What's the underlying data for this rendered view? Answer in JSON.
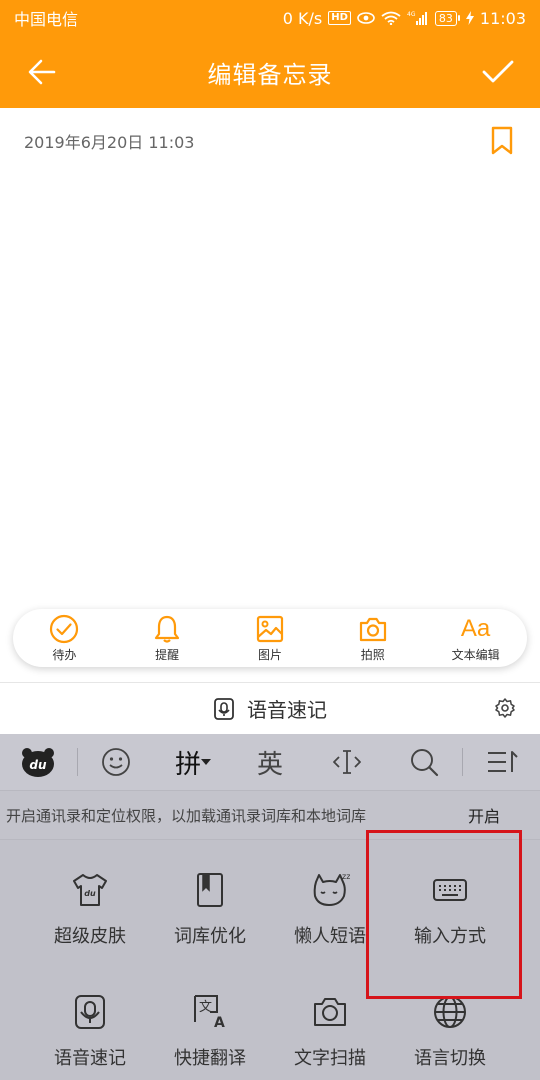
{
  "status_bar": {
    "carrier": "中国电信",
    "speed": "0 K/s",
    "hd": "HD",
    "network": "4G",
    "battery": "83",
    "time": "11:03"
  },
  "app_bar": {
    "title": "编辑备忘录",
    "back_icon": "arrow-left",
    "confirm_icon": "checkmark"
  },
  "note": {
    "date": "2019年6月20日 11:03",
    "bookmark_icon": "bookmark"
  },
  "toolbar": {
    "items": [
      {
        "label": "待办",
        "icon": "check-circle"
      },
      {
        "label": "提醒",
        "icon": "bell"
      },
      {
        "label": "图片",
        "icon": "image"
      },
      {
        "label": "拍照",
        "icon": "camera"
      },
      {
        "label": "文本编辑",
        "icon": "Aa"
      }
    ]
  },
  "voice_bar": {
    "label": "语音速记"
  },
  "keyboard": {
    "top_keys": [
      "du",
      "emoji",
      "拼",
      "英",
      "cursor",
      "search",
      "menu"
    ],
    "pinyin_label": "拼",
    "english_label": "英",
    "permission_text": "开启通讯录和定位权限，以加载通讯录词库和本地词库",
    "permission_action": "开启",
    "tools": [
      {
        "label": "超级皮肤",
        "icon": "tshirt-icon"
      },
      {
        "label": "词库优化",
        "icon": "book-icon"
      },
      {
        "label": "懒人短语",
        "icon": "sleeping-cat-icon"
      },
      {
        "label": "输入方式",
        "icon": "keyboard-icon"
      },
      {
        "label": "语音速记",
        "icon": "voice-note-icon"
      },
      {
        "label": "快捷翻译",
        "icon": "translate-icon"
      },
      {
        "label": "文字扫描",
        "icon": "camera-icon"
      },
      {
        "label": "语言切换",
        "icon": "globe-icon"
      }
    ]
  },
  "colors": {
    "accent": "#ff9a0a",
    "highlight_box": "#d6141a",
    "keyboard_bg": "#c1c1c9"
  }
}
